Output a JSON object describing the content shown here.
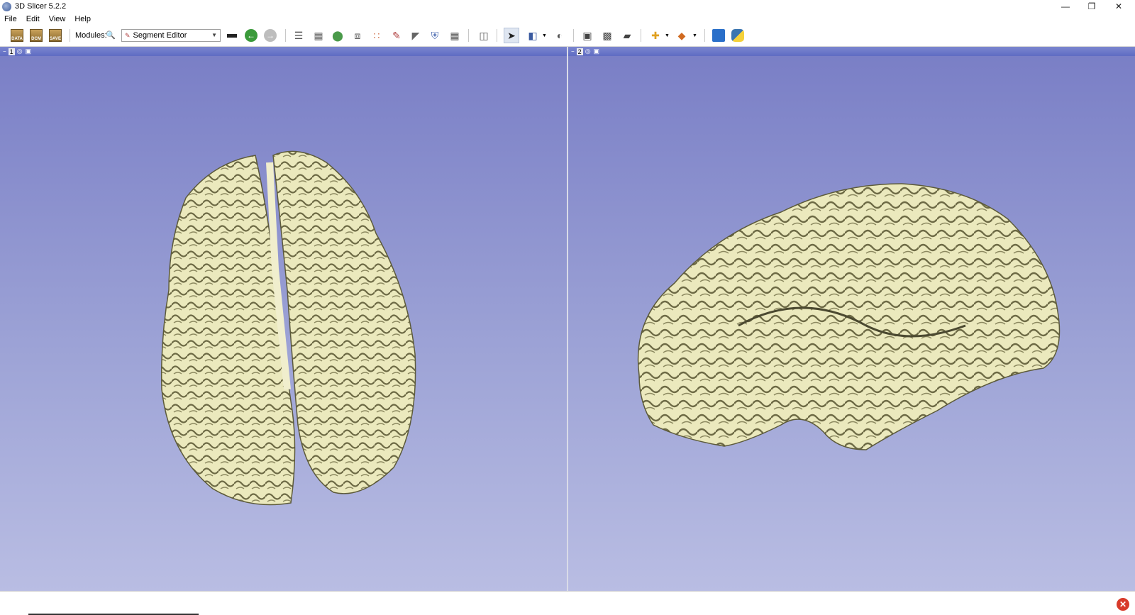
{
  "window": {
    "title": "3D Slicer 5.2.2"
  },
  "menu": [
    "File",
    "Edit",
    "View",
    "Help"
  ],
  "toolbar": {
    "data_label": "DATA",
    "dcm_label": "DCM",
    "save_label": "SAVE",
    "modules_label": "Modules:",
    "module_selected": "Segment Editor"
  },
  "views": [
    {
      "number": "1"
    },
    {
      "number": "2"
    }
  ],
  "colors": {
    "view_background_top": "#7a7fc6",
    "view_background_bottom": "#b9bde3",
    "brain_surface": "#e8e6b8",
    "view_header": "#6470c5"
  }
}
